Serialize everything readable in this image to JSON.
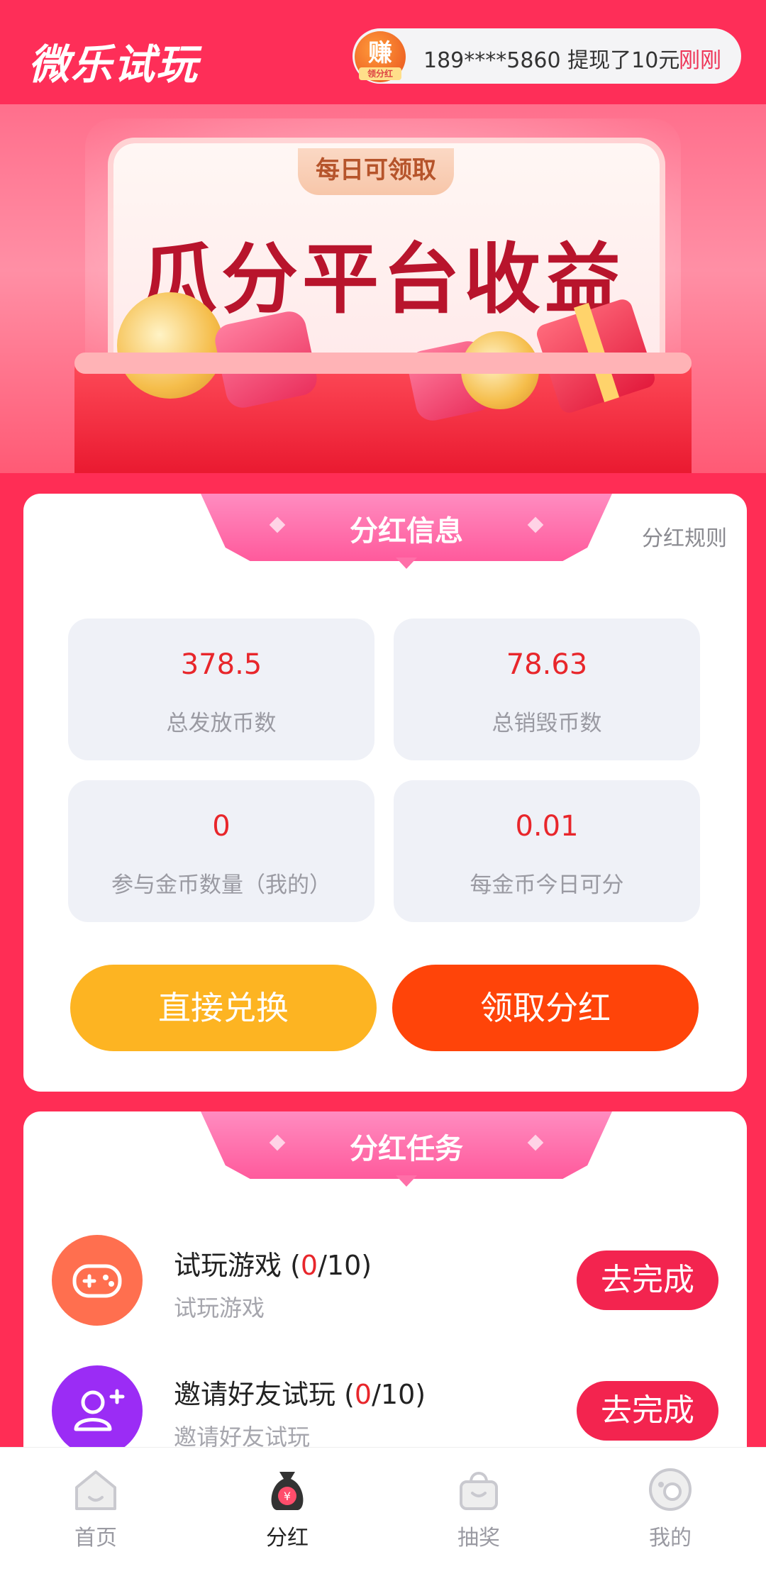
{
  "header": {
    "app_title": "微乐试玩",
    "ticker": {
      "badge": "赚",
      "badge_sub": "领分红",
      "text": "189****5860 提现了10元",
      "time": "刚刚"
    }
  },
  "banner": {
    "tag": "每日可领取",
    "title": "瓜分平台收益"
  },
  "dividend_info": {
    "title": "分红信息",
    "rules_link": "分红规则",
    "stats": [
      {
        "value": "378.5",
        "label": "总发放币数"
      },
      {
        "value": "78.63",
        "label": "总销毁币数"
      },
      {
        "value": "0",
        "label": "参与金币数量（我的）"
      },
      {
        "value": "0.01",
        "label": "每金币今日可分"
      }
    ],
    "buttons": {
      "exchange": "直接兑换",
      "claim": "领取分红"
    }
  },
  "dividend_tasks": {
    "title": "分红任务",
    "tasks": [
      {
        "name": "试玩游戏",
        "done": "0",
        "total": "/10)",
        "open": " (",
        "subtitle": "试玩游戏",
        "button": "去完成",
        "icon": "gamepad-icon",
        "color": "#ff6f4f"
      },
      {
        "name": "邀请好友试玩",
        "done": "0",
        "total": "/10)",
        "open": " (",
        "subtitle": "邀请好友试玩",
        "button": "去完成",
        "icon": "add-user-icon",
        "color": "#9b2cf5"
      }
    ]
  },
  "bottom_nav": {
    "items": [
      {
        "label": "首页",
        "icon": "home-icon",
        "active": false
      },
      {
        "label": "分红",
        "icon": "money-bag-icon",
        "active": true
      },
      {
        "label": "抽奖",
        "icon": "shopping-bag-icon",
        "active": false
      },
      {
        "label": "我的",
        "icon": "profile-icon",
        "active": false
      }
    ]
  },
  "colors": {
    "brand": "#fe2e58",
    "value_red": "#e8262b",
    "exchange_button": "#fdb422",
    "claim_button": "#ff4409",
    "task_button": "#f3244f"
  }
}
